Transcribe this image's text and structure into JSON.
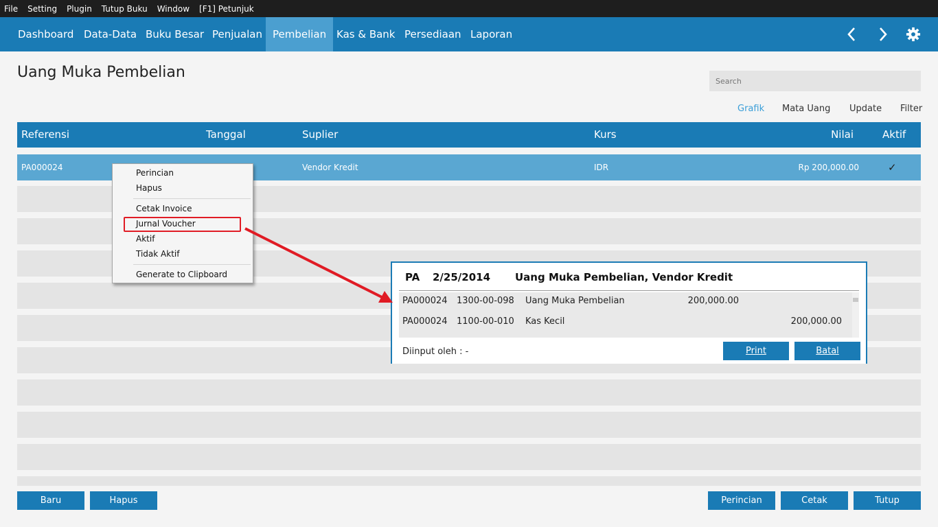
{
  "menubar": {
    "items": [
      "File",
      "Setting",
      "Plugin",
      "Tutup Buku",
      "Window",
      "[F1] Petunjuk"
    ]
  },
  "nav": {
    "items": [
      "Dashboard",
      "Data-Data",
      "Buku Besar",
      "Penjualan",
      "Pembelian",
      "Kas & Bank",
      "Persediaan",
      "Laporan"
    ],
    "active": "Pembelian",
    "icons": [
      "chevron-left-icon",
      "chevron-right-icon",
      "gear-icon"
    ]
  },
  "page": {
    "title": "Uang Muka Pembelian"
  },
  "search": {
    "placeholder": "Search"
  },
  "toolbar": {
    "grafik": "Grafik",
    "mata_uang": "Mata Uang",
    "update": "Update",
    "filter": "Filter"
  },
  "table": {
    "columns": {
      "referensi": "Referensi",
      "tanggal": "Tanggal",
      "suplier": "Suplier",
      "kurs": "Kurs",
      "nilai": "Nilai",
      "aktif": "Aktif"
    },
    "rows": [
      {
        "referensi": "PA000024",
        "tanggal": "",
        "suplier": "Vendor Kredit",
        "kurs": "IDR",
        "nilai": "Rp 200,000.00",
        "aktif": "✓"
      }
    ]
  },
  "context_menu": {
    "items": [
      "Perincian",
      "Hapus",
      "Cetak Invoice",
      "Jurnal Voucher",
      "Aktif",
      "Tidak Aktif",
      "Generate to Clipboard"
    ],
    "highlighted": "Jurnal Voucher"
  },
  "journal_voucher": {
    "code": "PA",
    "date": "2/25/2014",
    "title": "Uang Muka Pembelian, Vendor Kredit",
    "entries": [
      {
        "ref": "PA000024",
        "account": "1300-00-098",
        "name": "Uang Muka Pembelian",
        "debit": "200,000.00",
        "credit": ""
      },
      {
        "ref": "PA000024",
        "account": "1100-00-010",
        "name": "Kas Kecil",
        "debit": "",
        "credit": "200,000.00"
      }
    ],
    "footer": "Diinput oleh : -",
    "print_label": "Print",
    "cancel_label": "Batal"
  },
  "buttons": {
    "baru": "Baru",
    "hapus": "Hapus",
    "perincian": "Perincian",
    "cetak": "Cetak",
    "tutup": "Tutup"
  },
  "colors": {
    "primary": "#1a7bb5",
    "selected_row": "#5aa7d2",
    "highlight": "#e01b24"
  }
}
